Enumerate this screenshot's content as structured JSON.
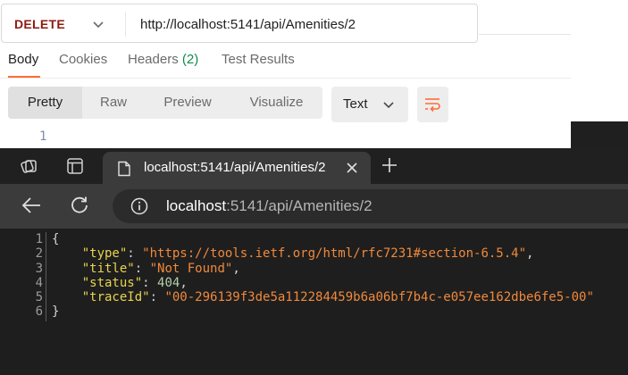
{
  "postman": {
    "method": "DELETE",
    "url": "http://localhost:5141/api/Amenities/2",
    "tabs": [
      {
        "label": "Body"
      },
      {
        "label": "Cookies"
      },
      {
        "label": "Headers",
        "count": "(2)"
      },
      {
        "label": "Test Results"
      }
    ],
    "view_modes": [
      "Pretty",
      "Raw",
      "Preview",
      "Visualize"
    ],
    "format": "Text",
    "response_line_number": "1"
  },
  "browser": {
    "tab_title": "localhost:5141/api/Amenities/2",
    "address_host": "localhost",
    "address_path": ":5141/api/Amenities/2"
  },
  "json_view": {
    "line_numbers": [
      "1",
      "2",
      "3",
      "4",
      "5",
      "6"
    ],
    "open_brace": "{",
    "close_brace": "}",
    "fields": [
      {
        "key": "\"type\"",
        "value": "\"https://tools.ietf.org/html/rfc7231#section-6.5.4\"",
        "kind": "string",
        "comma": ","
      },
      {
        "key": "\"title\"",
        "value": "\"Not Found\"",
        "kind": "string",
        "comma": ","
      },
      {
        "key": "\"status\"",
        "value": "404",
        "kind": "number",
        "comma": ","
      },
      {
        "key": "\"traceId\"",
        "value": "\"00-296139f3de5a112284459b6a06bf7b4c-e057ee162dbe6fe5-00\"",
        "kind": "string",
        "comma": ""
      }
    ]
  },
  "colors": {
    "method": "#8e1a10",
    "accent": "#ff6c37",
    "headers_count": "#0e8a4f",
    "json_key": "#e8d44d",
    "json_string": "#f0893c",
    "json_number": "#b5cea8"
  },
  "icons": [
    "chevron-down-icon",
    "wrap-lines-icon",
    "workspaces-icon",
    "tab-actions-icon",
    "page-icon",
    "close-icon",
    "plus-icon",
    "back-arrow-icon",
    "reload-icon",
    "info-icon"
  ]
}
